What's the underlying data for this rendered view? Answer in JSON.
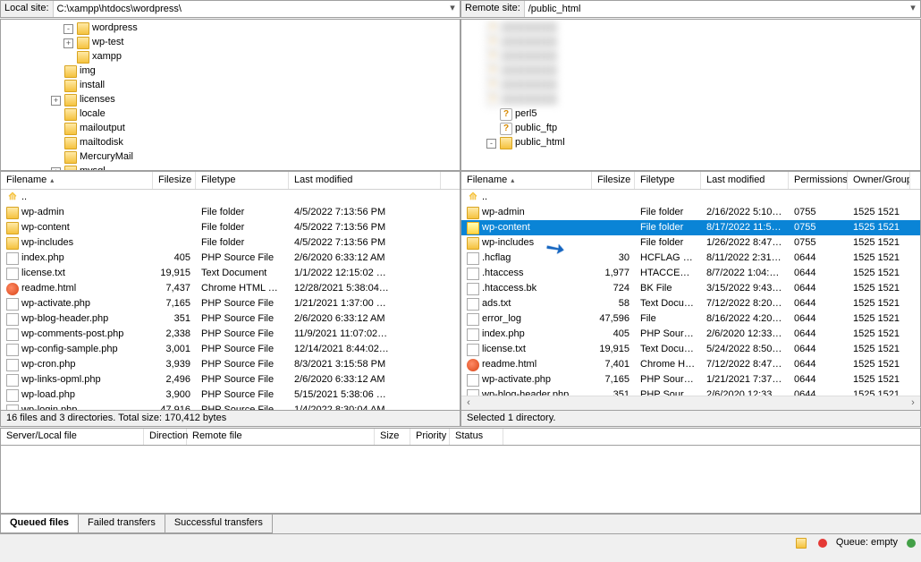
{
  "local": {
    "label": "Local site:",
    "path": "C:\\xampp\\htdocs\\wordpress\\",
    "tree": [
      {
        "depth": 5,
        "toggle": "-",
        "name": "wordpress"
      },
      {
        "depth": 5,
        "toggle": "+",
        "name": "wp-test"
      },
      {
        "depth": 5,
        "toggle": "",
        "name": "xampp"
      },
      {
        "depth": 4,
        "toggle": "",
        "name": "img"
      },
      {
        "depth": 4,
        "toggle": "",
        "name": "install"
      },
      {
        "depth": 4,
        "toggle": "+",
        "name": "licenses"
      },
      {
        "depth": 4,
        "toggle": "",
        "name": "locale"
      },
      {
        "depth": 4,
        "toggle": "",
        "name": "mailoutput"
      },
      {
        "depth": 4,
        "toggle": "",
        "name": "mailtodisk"
      },
      {
        "depth": 4,
        "toggle": "",
        "name": "MercuryMail"
      },
      {
        "depth": 4,
        "toggle": "+",
        "name": "mysql"
      }
    ],
    "cols": [
      "Filename",
      "Filesize",
      "Filetype",
      "Last modified"
    ],
    "files": [
      {
        "icon": "up",
        "name": "..",
        "size": "",
        "type": "",
        "mod": ""
      },
      {
        "icon": "folder",
        "name": "wp-admin",
        "size": "",
        "type": "File folder",
        "mod": "4/5/2022 7:13:56 PM"
      },
      {
        "icon": "folder",
        "name": "wp-content",
        "size": "",
        "type": "File folder",
        "mod": "4/5/2022 7:13:56 PM"
      },
      {
        "icon": "folder",
        "name": "wp-includes",
        "size": "",
        "type": "File folder",
        "mod": "4/5/2022 7:13:56 PM"
      },
      {
        "icon": "file",
        "name": "index.php",
        "size": "405",
        "type": "PHP Source File",
        "mod": "2/6/2020 6:33:12 AM"
      },
      {
        "icon": "file",
        "name": "license.txt",
        "size": "19,915",
        "type": "Text Document",
        "mod": "1/1/2022 12:15:02 …"
      },
      {
        "icon": "html",
        "name": "readme.html",
        "size": "7,437",
        "type": "Chrome HTML Do…",
        "mod": "12/28/2021 5:38:04…"
      },
      {
        "icon": "file",
        "name": "wp-activate.php",
        "size": "7,165",
        "type": "PHP Source File",
        "mod": "1/21/2021 1:37:00 …"
      },
      {
        "icon": "file",
        "name": "wp-blog-header.php",
        "size": "351",
        "type": "PHP Source File",
        "mod": "2/6/2020 6:33:12 AM"
      },
      {
        "icon": "file",
        "name": "wp-comments-post.php",
        "size": "2,338",
        "type": "PHP Source File",
        "mod": "11/9/2021 11:07:02…"
      },
      {
        "icon": "file",
        "name": "wp-config-sample.php",
        "size": "3,001",
        "type": "PHP Source File",
        "mod": "12/14/2021 8:44:02…"
      },
      {
        "icon": "file",
        "name": "wp-cron.php",
        "size": "3,939",
        "type": "PHP Source File",
        "mod": "8/3/2021 3:15:58 PM"
      },
      {
        "icon": "file",
        "name": "wp-links-opml.php",
        "size": "2,496",
        "type": "PHP Source File",
        "mod": "2/6/2020 6:33:12 AM"
      },
      {
        "icon": "file",
        "name": "wp-load.php",
        "size": "3,900",
        "type": "PHP Source File",
        "mod": "5/15/2021 5:38:06 …"
      },
      {
        "icon": "file",
        "name": "wp-login.php",
        "size": "47,916",
        "type": "PHP Source File",
        "mod": "1/4/2022 8:30:04 AM"
      }
    ],
    "status": "16 files and 3 directories. Total size: 170,412 bytes"
  },
  "remote": {
    "label": "Remote site:",
    "path": "/public_html",
    "tree_blur": 6,
    "tree": [
      {
        "depth": 2,
        "toggle": "",
        "icon": "q",
        "name": "perl5"
      },
      {
        "depth": 2,
        "toggle": "",
        "icon": "q",
        "name": "public_ftp"
      },
      {
        "depth": 2,
        "toggle": "-",
        "icon": "folder",
        "name": "public_html"
      }
    ],
    "cols": [
      "Filename",
      "Filesize",
      "Filetype",
      "Last modified",
      "Permissions",
      "Owner/Group"
    ],
    "files": [
      {
        "icon": "up",
        "name": "..",
        "size": "",
        "type": "",
        "mod": "",
        "perm": "",
        "own": ""
      },
      {
        "icon": "folder",
        "name": "wp-admin",
        "size": "",
        "type": "File folder",
        "mod": "2/16/2022 5:10:…",
        "perm": "0755",
        "own": "1525 1521"
      },
      {
        "icon": "folder",
        "name": "wp-content",
        "size": "",
        "type": "File folder",
        "mod": "8/17/2022 11:5…",
        "perm": "0755",
        "own": "1525 1521",
        "sel": true
      },
      {
        "icon": "folder",
        "name": "wp-includes",
        "size": "",
        "type": "File folder",
        "mod": "1/26/2022 8:47:…",
        "perm": "0755",
        "own": "1525 1521"
      },
      {
        "icon": "file",
        "name": ".hcflag",
        "size": "30",
        "type": "HCFLAG File",
        "mod": "8/11/2022 2:31:…",
        "perm": "0644",
        "own": "1525 1521"
      },
      {
        "icon": "file",
        "name": ".htaccess",
        "size": "1,977",
        "type": "HTACCESS…",
        "mod": "8/7/2022 1:04:2…",
        "perm": "0644",
        "own": "1525 1521"
      },
      {
        "icon": "file",
        "name": ".htaccess.bk",
        "size": "724",
        "type": "BK File",
        "mod": "3/15/2022 9:43:…",
        "perm": "0644",
        "own": "1525 1521"
      },
      {
        "icon": "file",
        "name": "ads.txt",
        "size": "58",
        "type": "Text Docu…",
        "mod": "7/12/2022 8:20:…",
        "perm": "0644",
        "own": "1525 1521"
      },
      {
        "icon": "file",
        "name": "error_log",
        "size": "47,596",
        "type": "File",
        "mod": "8/16/2022 4:20:…",
        "perm": "0644",
        "own": "1525 1521"
      },
      {
        "icon": "file",
        "name": "index.php",
        "size": "405",
        "type": "PHP Sourc…",
        "mod": "2/6/2020 12:33:…",
        "perm": "0644",
        "own": "1525 1521"
      },
      {
        "icon": "file",
        "name": "license.txt",
        "size": "19,915",
        "type": "Text Docu…",
        "mod": "5/24/2022 8:50:…",
        "perm": "0644",
        "own": "1525 1521"
      },
      {
        "icon": "html",
        "name": "readme.html",
        "size": "7,401",
        "type": "Chrome H…",
        "mod": "7/12/2022 8:47:…",
        "perm": "0644",
        "own": "1525 1521"
      },
      {
        "icon": "file",
        "name": "wp-activate.php",
        "size": "7,165",
        "type": "PHP Sourc…",
        "mod": "1/21/2021 7:37:…",
        "perm": "0644",
        "own": "1525 1521"
      },
      {
        "icon": "file",
        "name": "wp-blog-header.php",
        "size": "351",
        "type": "PHP Sourc…",
        "mod": "2/6/2020 12:33:…",
        "perm": "0644",
        "own": "1525 1521"
      }
    ],
    "status": "Selected 1 directory."
  },
  "queue": {
    "cols": [
      "Server/Local file",
      "Direction",
      "Remote file",
      "Size",
      "Priority",
      "Status"
    ],
    "tabs": [
      "Queued files",
      "Failed transfers",
      "Successful transfers"
    ],
    "active_tab": 0
  },
  "footer": {
    "queue_label": "Queue: empty"
  }
}
